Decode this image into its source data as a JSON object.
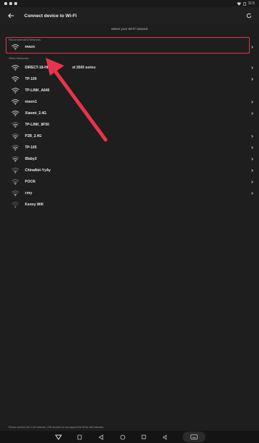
{
  "status_bar": {
    "time": "11:5"
  },
  "app_bar": {
    "title": "Connect device to Wi-Fi"
  },
  "subtitle": "Select your Wi-Fi network",
  "recommended": {
    "label": "Recommended Networks",
    "networks": [
      {
        "name": "mwzn"
      }
    ]
  },
  "other": {
    "label": "Other Networks",
    "networks": [
      {
        "name": "DIRECT-18-HP",
        "name_suffix": "et 2600 series"
      },
      {
        "name": "TP-100"
      },
      {
        "name": "TP-LINK_A640"
      },
      {
        "name": "mwzn1"
      },
      {
        "name": "Xiaomi_2.4G"
      },
      {
        "name": "TP-LINK_8F50"
      },
      {
        "name": "P2B_2.4G"
      },
      {
        "name": "TP-105"
      },
      {
        "name": "iBaby3"
      },
      {
        "name": "ChinaNet-YyAy"
      },
      {
        "name": "POCN"
      },
      {
        "name": "cmy"
      },
      {
        "name": "Kenny Wifi"
      }
    ]
  },
  "footer_note": "Please connect the 2.4G network, LED devices do not support the 5Ghz wifi networks.",
  "colors": {
    "highlight": "#d93b4b",
    "arrow": "#e8344a",
    "background": "#1e1e1e"
  }
}
